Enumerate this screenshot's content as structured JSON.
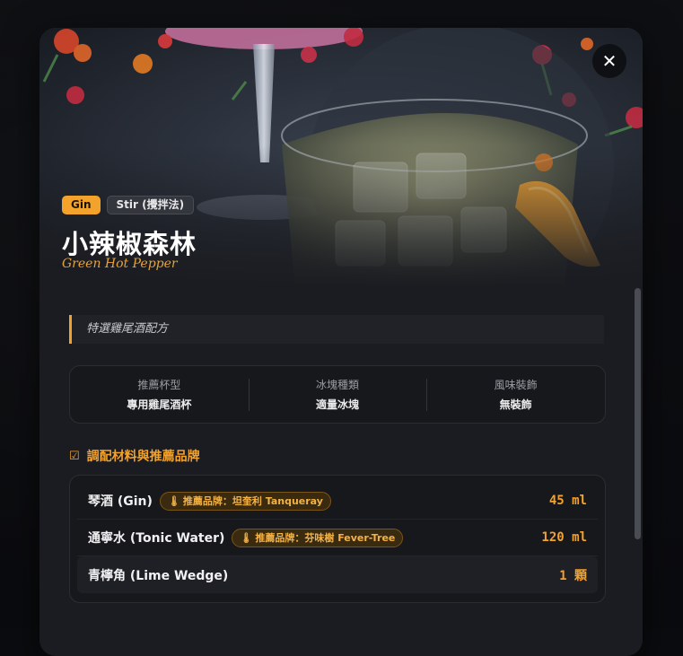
{
  "header": {
    "close_icon": "✕"
  },
  "tags": {
    "spirit": "Gin",
    "method": "Stir (攪拌法)"
  },
  "title": {
    "zh": "小辣椒森林",
    "en": "Green Hot Pepper"
  },
  "description": "特選雞尾酒配方",
  "info": [
    {
      "label": "推薦杯型",
      "value": "專用雞尾酒杯"
    },
    {
      "label": "冰塊種類",
      "value": "適量冰塊"
    },
    {
      "label": "風味裝飾",
      "value": "無裝飾"
    }
  ],
  "section": {
    "icon": "list-check-icon",
    "title": "調配材料與推薦品牌"
  },
  "ingredients": [
    {
      "name": "琴酒 (Gin)",
      "brand": "推薦品牌：坦奎利 Tanqueray",
      "amount": "45 ml"
    },
    {
      "name": "通寧水 (Tonic Water)",
      "brand": "推薦品牌：芬味樹 Fever-Tree",
      "amount": "120 ml"
    },
    {
      "name": "青檸角 (Lime Wedge)",
      "brand": "",
      "amount": "1 顆"
    }
  ],
  "colors": {
    "accent": "#f3a22c",
    "modal_bg": "#1b1c21",
    "panel_bg": "#17181c"
  }
}
